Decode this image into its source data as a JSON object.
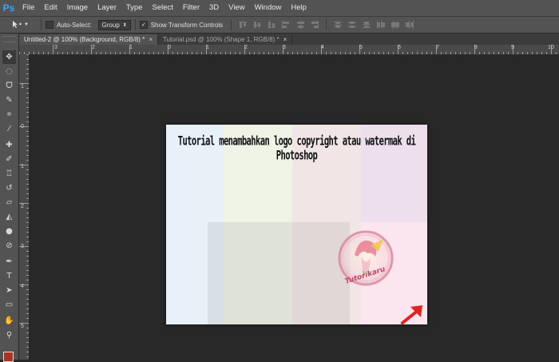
{
  "app": {
    "logo": "Ps"
  },
  "menu": [
    "File",
    "Edit",
    "Image",
    "Layer",
    "Type",
    "Select",
    "Filter",
    "3D",
    "View",
    "Window",
    "Help"
  ],
  "options": {
    "tool_icon": "move-tool-icon",
    "auto_select_label": "Auto-Select:",
    "auto_select_checked": false,
    "auto_select_target": "Group",
    "show_transform_label": "Show Transform Controls",
    "show_transform_checked": true
  },
  "tabs": [
    {
      "title": "Untitled-2 @ 100% (Background, RGB/8) *",
      "active": true,
      "close": "×"
    },
    {
      "title": "Tutorial.psd @ 100% (Shape 1, RGB/8) *",
      "active": false,
      "close": "×"
    }
  ],
  "ruler": {
    "top_labels": [
      "3",
      "2",
      "1",
      "0",
      "1",
      "2",
      "3",
      "4",
      "5",
      "6",
      "7",
      "8",
      "9",
      "10"
    ],
    "left_labels": [
      "1",
      "0",
      "1",
      "2",
      "3",
      "4",
      "5"
    ]
  },
  "toolbar_icons": [
    "move-tool-icon",
    "marquee-tool-icon",
    "lasso-tool-icon",
    "quick-selection-tool-icon",
    "crop-tool-icon",
    "eyedropper-tool-icon",
    "healing-brush-tool-icon",
    "brush-tool-icon",
    "clone-stamp-tool-icon",
    "history-brush-tool-icon",
    "eraser-tool-icon",
    "paint-bucket-tool-icon",
    "blur-tool-icon",
    "dodge-tool-icon",
    "pen-tool-icon",
    "type-tool-icon",
    "path-selection-tool-icon",
    "rectangle-tool-icon",
    "hand-tool-icon",
    "zoom-tool-icon"
  ],
  "colors": {
    "foreground": "#b5301c"
  },
  "canvas": {
    "title": "Tutorial menambahkan logo copyright atau watermak di Photoshop",
    "watermark_text": "Tutorikaru",
    "stripe_colors": [
      "#e8f1f7",
      "#eef3e6",
      "#f1e6e5",
      "#ede0ec"
    ]
  }
}
